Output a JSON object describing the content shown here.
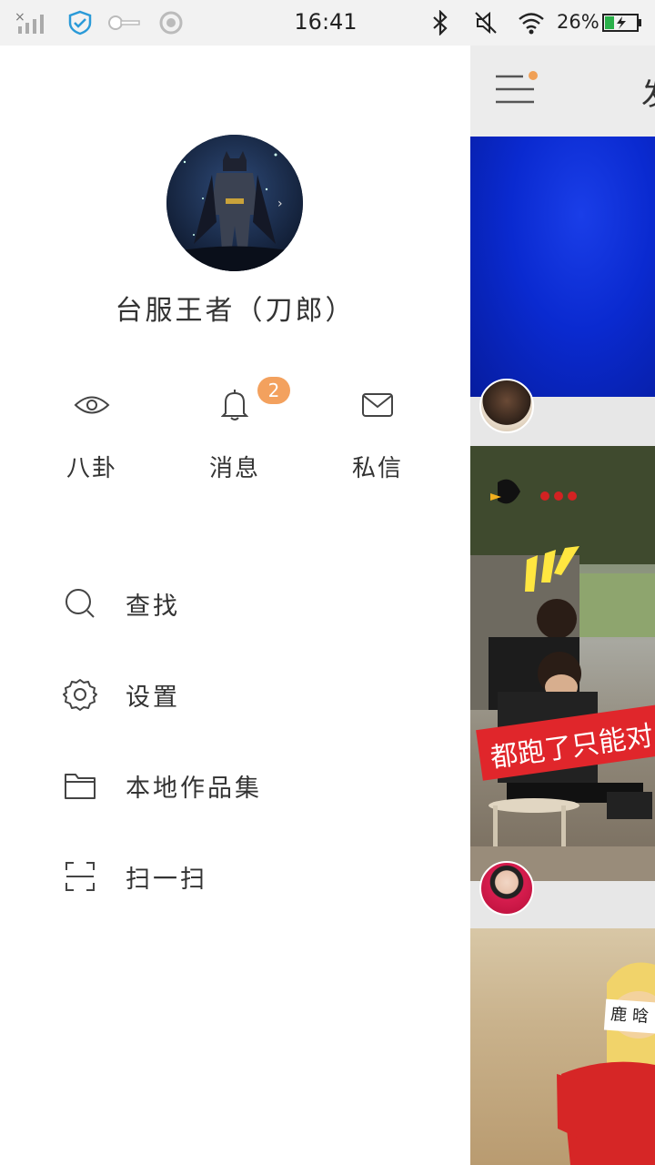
{
  "status_bar": {
    "time": "16:41",
    "battery": "26%",
    "icons": [
      "no-signal-icon",
      "shield-check-icon",
      "key-icon",
      "sync-icon",
      "bluetooth-icon",
      "mute-icon",
      "wifi-icon",
      "battery-charging-icon"
    ]
  },
  "profile": {
    "avatar": "user-avatar",
    "name": "台服王者（刀郎）"
  },
  "quick_actions": [
    {
      "label": "八卦",
      "icon": "eye-icon"
    },
    {
      "label": "消息",
      "icon": "bell-icon",
      "badge": "2"
    },
    {
      "label": "私信",
      "icon": "mail-icon"
    }
  ],
  "menu": [
    {
      "label": "查找",
      "icon": "search-icon"
    },
    {
      "label": "设置",
      "icon": "gear-icon"
    },
    {
      "label": "本地作品集",
      "icon": "folder-icon"
    },
    {
      "label": "扫一扫",
      "icon": "scan-icon"
    }
  ],
  "content": {
    "title_peek": "发",
    "video_caption": "都跑了只能对",
    "bib_text": "鹿晗"
  },
  "colors": {
    "badge": "#f3a15e",
    "menu_dot": "#f0a056",
    "text": "#333333"
  }
}
